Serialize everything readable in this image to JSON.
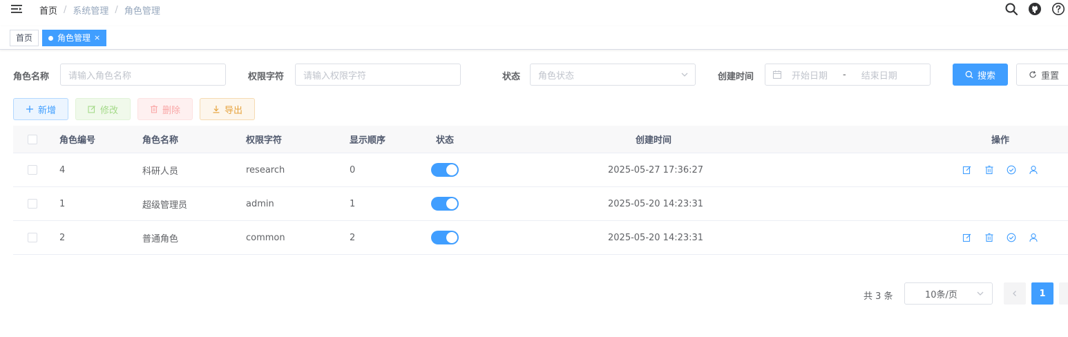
{
  "breadcrumb": [
    "首页",
    "系统管理",
    "角色管理"
  ],
  "tags": [
    {
      "label": "首页",
      "active": false
    },
    {
      "label": "角色管理",
      "active": true
    }
  ],
  "search": {
    "role_name_label": "角色名称",
    "role_name_placeholder": "请输入角色名称",
    "role_key_label": "权限字符",
    "role_key_placeholder": "请输入权限字符",
    "status_label": "状态",
    "status_placeholder": "角色状态",
    "created_label": "创建时间",
    "start_placeholder": "开始日期",
    "range_sep": "-",
    "end_placeholder": "结束日期",
    "search_button": "搜索",
    "reset_button": "重置"
  },
  "toolbar": {
    "add": "新增",
    "edit": "修改",
    "delete": "删除",
    "export": "导出"
  },
  "table": {
    "headers": [
      "角色编号",
      "角色名称",
      "权限字符",
      "显示顺序",
      "状态",
      "创建时间",
      "操作"
    ],
    "rows": [
      {
        "id": "4",
        "name": "科研人员",
        "key": "research",
        "order": "0",
        "status": true,
        "created": "2025-05-27 17:36:27",
        "has_ops": true
      },
      {
        "id": "1",
        "name": "超级管理员",
        "key": "admin",
        "order": "1",
        "status": true,
        "created": "2025-05-20 14:23:31",
        "has_ops": false
      },
      {
        "id": "2",
        "name": "普通角色",
        "key": "common",
        "order": "2",
        "status": true,
        "created": "2025-05-20 14:23:31",
        "has_ops": true
      }
    ]
  },
  "pagination": {
    "total_text": "共 3 条",
    "page_size": "10条/页",
    "current_page": "1"
  },
  "colors": {
    "primary": "#409eff",
    "success": "#67c23a",
    "danger": "#f56c6c",
    "warning": "#e6a23c"
  }
}
